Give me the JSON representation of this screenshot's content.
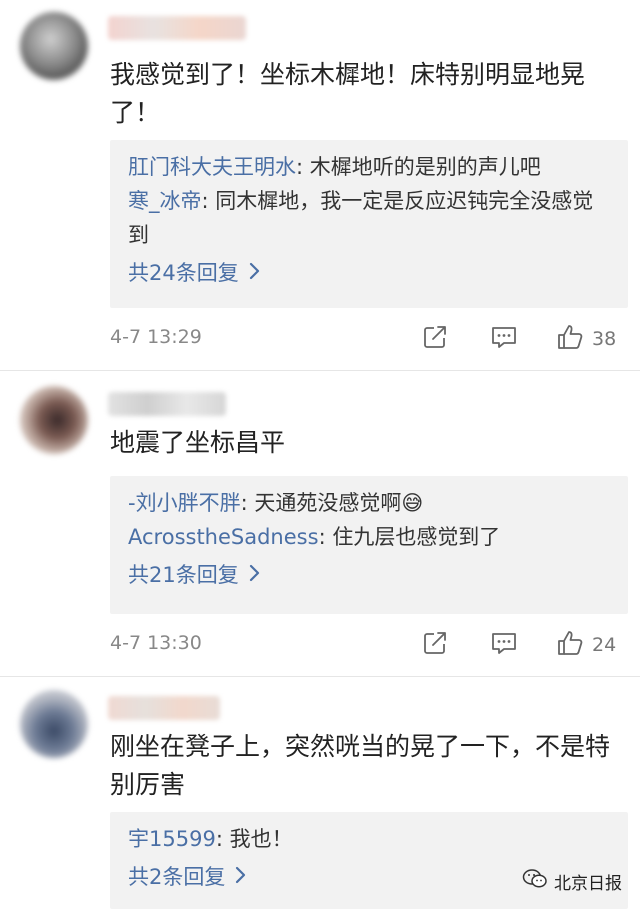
{
  "comments": [
    {
      "text": "我感觉到了！坐标木樨地！床特别明显地晃了！",
      "replies": [
        {
          "user": "肛门科大夫王明水",
          "text": ": 木樨地听的是别的声儿吧"
        },
        {
          "user": "寒_冰帝",
          "text": ": 同木樨地，我一定是反应迟钝完全没感觉到"
        }
      ],
      "more": "共24条回复",
      "time": "4-7 13:29",
      "likes": "38"
    },
    {
      "text": "地震了坐标昌平",
      "replies": [
        {
          "user": "-刘小胖不胖",
          "text": ": 天通苑没感觉啊😅"
        },
        {
          "user": "AcrosstheSadness",
          "text": ": 住九层也感觉到了"
        }
      ],
      "more": "共21条回复",
      "time": "4-7 13:30",
      "likes": "24"
    },
    {
      "text": "刚坐在凳子上，突然咣当的晃了一下，不是特别厉害",
      "replies": [
        {
          "user": "宇15599",
          "text": ": 我也！"
        }
      ],
      "more": "共2条回复"
    }
  ],
  "icons": {
    "repost": "repost-icon",
    "comment": "comment-icon",
    "like": "thumbs-up-icon",
    "chevron": "chevron-right-icon",
    "wechat": "wechat-icon"
  },
  "colors": {
    "reply_user": "#4a6fa5",
    "reply_bg": "#f2f2f2"
  },
  "watermark": "北京日报"
}
